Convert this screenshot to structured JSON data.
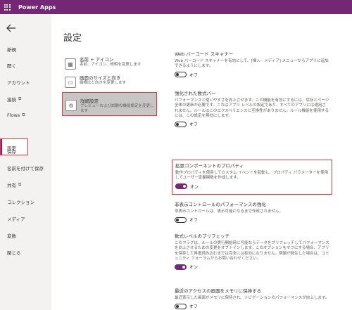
{
  "app": {
    "title": "Power Apps"
  },
  "sidebar": {
    "items": [
      {
        "label": "新規"
      },
      {
        "label": "開く"
      },
      {
        "label": "アカウント"
      },
      {
        "label": "接続"
      },
      {
        "label": "Flows"
      },
      {
        "label": "設定"
      },
      {
        "label": "保存"
      },
      {
        "label": "名前を付けて保存"
      },
      {
        "label": "共有"
      },
      {
        "label": "コレクション"
      },
      {
        "label": "メディア"
      },
      {
        "label": "変数"
      },
      {
        "label": "閉じる"
      }
    ]
  },
  "main": {
    "title": "設定",
    "categories": [
      {
        "title": "名前 + アイコン",
        "subtitle": "名前、アイコン、説明を変更します",
        "icon": "app-icon"
      },
      {
        "title": "画面のサイズと向き",
        "subtitle": "縦横比と向きを変更します",
        "icon": "screen-size-icon"
      },
      {
        "title": "詳細設定",
        "subtitle": "プレビューおよび試験の機能設定を変更します",
        "icon": "gear-icon"
      }
    ],
    "settings": [
      {
        "title": "Web バーコード スキャナー",
        "desc": "Web バーコード スキャナーを有効にして、[挿入 - メディア] メニューからアプリに追加できるようにします。",
        "state": "オフ",
        "on": false
      },
      {
        "title": "強化された数式バー",
        "desc": "パフォーマンスと使いやすさを向上させます。この機能を有効にするには、保存とページ全体の更新が必要です。これはアプリ レベルの設定であり、すべてのアプリには適用されません。ルールはこのエクスペリエンスと互換性がありません。ルール機能を使用するには、この設定を無効にします。",
        "state": "オフ",
        "on": false
      },
      {
        "title": "拡張コンポーネントのプロパティ",
        "desc": "動作プロパティを使用してカスタム イベントを起動し、プロパティ パラメーターを使用してユーザー定義関数を作成します。",
        "state": "オン",
        "on": true
      },
      {
        "title": "非表示コントロールのパフォーマンスの強化",
        "desc": "非表示コントロールは、表示可能になるまで作成されません。",
        "state": "オフ",
        "on": false
      },
      {
        "title": "数式レベルのプリフェッチ",
        "desc": "このフラグは、ルールの実行開始時に可能ならデータをプリフェッチしてパフォーマンスを向上させるための変更をオプトインします。このオプションをオフにする場合、アプリを保存して再度読み込むまでは完全には有効になりません。問題が発生した場合は、コミュニティ フォーラムからお問い合わせください。",
        "state": "オン",
        "on": true
      },
      {
        "title": "最近のアクセスの画面をメモリに保持する",
        "desc": "最近表示した画面がメモリに保持され、ナビゲーションのパフォーマンスが向上します。",
        "state": "オフ",
        "on": false
      }
    ]
  },
  "colors": {
    "brand": "#742774",
    "highlight": "#e8393a"
  }
}
